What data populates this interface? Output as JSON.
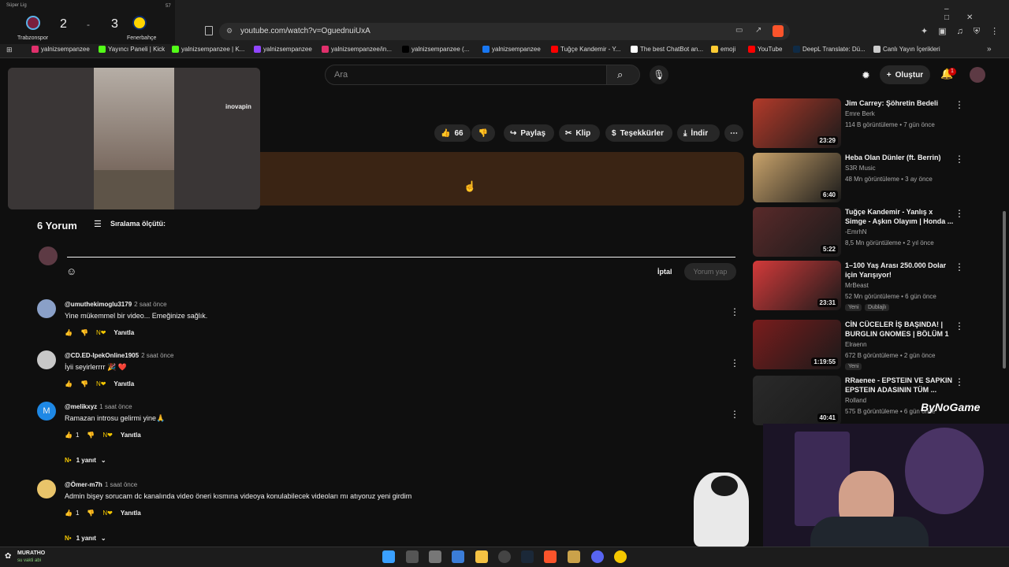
{
  "scoreboard": {
    "league": "Süper Lig",
    "minute": "57",
    "home_team": "Trabzonspor",
    "home_score": "2",
    "separator": "-",
    "away_score": "3",
    "away_team": "Fenerbahçe"
  },
  "browser": {
    "url": "youtube.com/watch?v=OguednuiUxA",
    "bookmarks": [
      {
        "label": "yalnizsempanzee",
        "color": "#e1306c"
      },
      {
        "label": "Yayıncı Paneli | Kick",
        "color": "#53fc18"
      },
      {
        "label": "yalnizsempanzee | K...",
        "color": "#53fc18"
      },
      {
        "label": "yalnizsempanzee",
        "color": "#9146ff"
      },
      {
        "label": "yalnizsempanzee/in...",
        "color": "#e1306c"
      },
      {
        "label": "yalnizsempanzee (...",
        "color": "#000000"
      },
      {
        "label": "yalnizsempanzee",
        "color": "#1877f2"
      },
      {
        "label": "Tuğçe Kandemir - Y...",
        "color": "#ff0000"
      },
      {
        "label": "The best ChatBot an...",
        "color": "#ffffff"
      },
      {
        "label": "emoji",
        "color": "#ffcc33"
      },
      {
        "label": "YouTube",
        "color": "#ff0000"
      },
      {
        "label": "DeepL Translate: Dü...",
        "color": "#0f2b46"
      },
      {
        "label": "Canlı Yayın İçerikleri",
        "color": "#cccccc"
      }
    ]
  },
  "youtube": {
    "search_placeholder": "Ara",
    "create_label": "Oluştur",
    "notif_count": "1",
    "miniplayer_brand": "inovapin",
    "actions": {
      "likes": "66",
      "share": "Paylaş",
      "clip": "Klip",
      "thanks": "Teşekkürler",
      "download": "İndir"
    },
    "comments_title": "6 Yorum",
    "sort_label": "Sıralama ölçütü:",
    "cancel_label": "İptal",
    "submit_label": "Yorum yap",
    "reply_label": "Yanıtla",
    "comments": [
      {
        "user": "@umuthekimoglu3179",
        "time": "2 saat önce",
        "text": "Yine mükemmel bir video... Emeğinize sağlık.",
        "likes": "",
        "avatar": "#8aa0c8"
      },
      {
        "user": "@CD.ED-IpekOnline1905",
        "time": "2 saat önce",
        "text": "İyii seyirlerrrr 🎉 ❤️",
        "likes": "",
        "avatar": "#c8c8c8"
      },
      {
        "user": "@melikxyz",
        "time": "1 saat önce",
        "text": "Ramazan introsu gelirmi yine🙏",
        "likes": "1",
        "avatar": "#1e88e5",
        "initial": "M",
        "replies": "1 yanıt"
      },
      {
        "user": "@Ömer-m7h",
        "time": "1 saat önce",
        "text": "Admin bişey sorucam dc kanalında video öneri kısmına videoya konulabilecek videoları mı atıyoruz yeni girdim",
        "likes": "1",
        "avatar": "#e9c46a",
        "replies": "1 yanıt"
      }
    ],
    "recommendations": [
      {
        "title": "Jim Carrey: Şöhretin Bedeli",
        "channel": "Emre Berk",
        "meta": "114 B görüntüleme • 7 gün önce",
        "duration": "23:29",
        "thumb": "#b23a2a"
      },
      {
        "title": "Heba Olan Dünler (ft. Berrin)",
        "channel": "S3R Music",
        "meta": "48 Mn görüntüleme • 3 ay önce",
        "duration": "6:40",
        "thumb": "#c9a36b"
      },
      {
        "title": "Tuğçe Kandemir - Yanlış x Simge - Aşkın Olayım | Honda ...",
        "channel": "-EmrhN",
        "meta": "8,5 Mn görüntüleme • 2 yıl önce",
        "duration": "5:22",
        "thumb": "#5a2a2a"
      },
      {
        "title": "1–100 Yaş Arası 250.000 Dolar için Yarışıyor!",
        "channel": "MrBeast",
        "meta": "52 Mn görüntüleme • 6 gün önce",
        "duration": "23:31",
        "thumb": "#d33a3a",
        "badge1": "Yeni",
        "badge2": "Dublajlı"
      },
      {
        "title": "CİN CÜCELER İŞ BAŞINDA! | BURGLIN GNOMES | BÖLÜM 1",
        "channel": "Elraenn",
        "meta": "672 B görüntüleme • 2 gün önce",
        "duration": "1:19:55",
        "thumb": "#7a1c1c",
        "badge1": "Yeni"
      },
      {
        "title": "RRaenee - EPSTEIN VE SAPKIN EPSTEIN ADASININ TÜM ...",
        "channel": "Rolland",
        "meta": "575 B görüntüleme • 6 gün önce",
        "duration": "40:41",
        "thumb": "#2a2a2a"
      }
    ],
    "watermark": "ByNoGame"
  },
  "taskbar": {
    "user": "MURATHO",
    "status": "su vakti abi"
  }
}
